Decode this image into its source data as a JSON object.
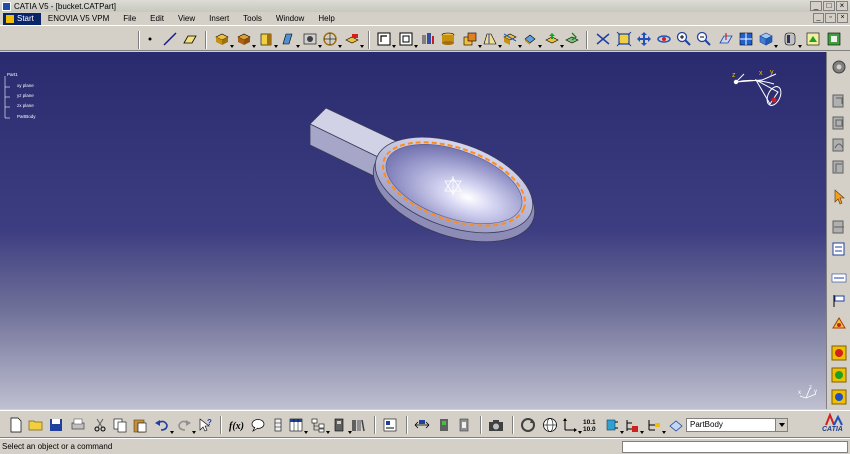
{
  "window": {
    "title": "CATIA V5 - [bucket.CATPart]"
  },
  "menu": {
    "items": [
      "Start",
      "ENOVIA V5 VPM",
      "File",
      "Edit",
      "View",
      "Insert",
      "Tools",
      "Window",
      "Help"
    ]
  },
  "tree": {
    "root": "Part1",
    "children": [
      "xy plane",
      "yz plane",
      "zx plane",
      "PartBody"
    ]
  },
  "compass": {
    "labels": [
      "z",
      "x",
      "y"
    ]
  },
  "corner_axes": {
    "labels": [
      "z",
      "y",
      "x"
    ]
  },
  "status": {
    "message": "Select an object or a command"
  },
  "body_select": {
    "value": "PartBody"
  },
  "logo": {
    "text": "CATIA"
  },
  "colors": {
    "viewport_top": "#2a2a6e",
    "viewport_bottom": "#bfc0d0",
    "part_surface": "#c8c8e8",
    "selection_edge": "#ff8c1a"
  }
}
